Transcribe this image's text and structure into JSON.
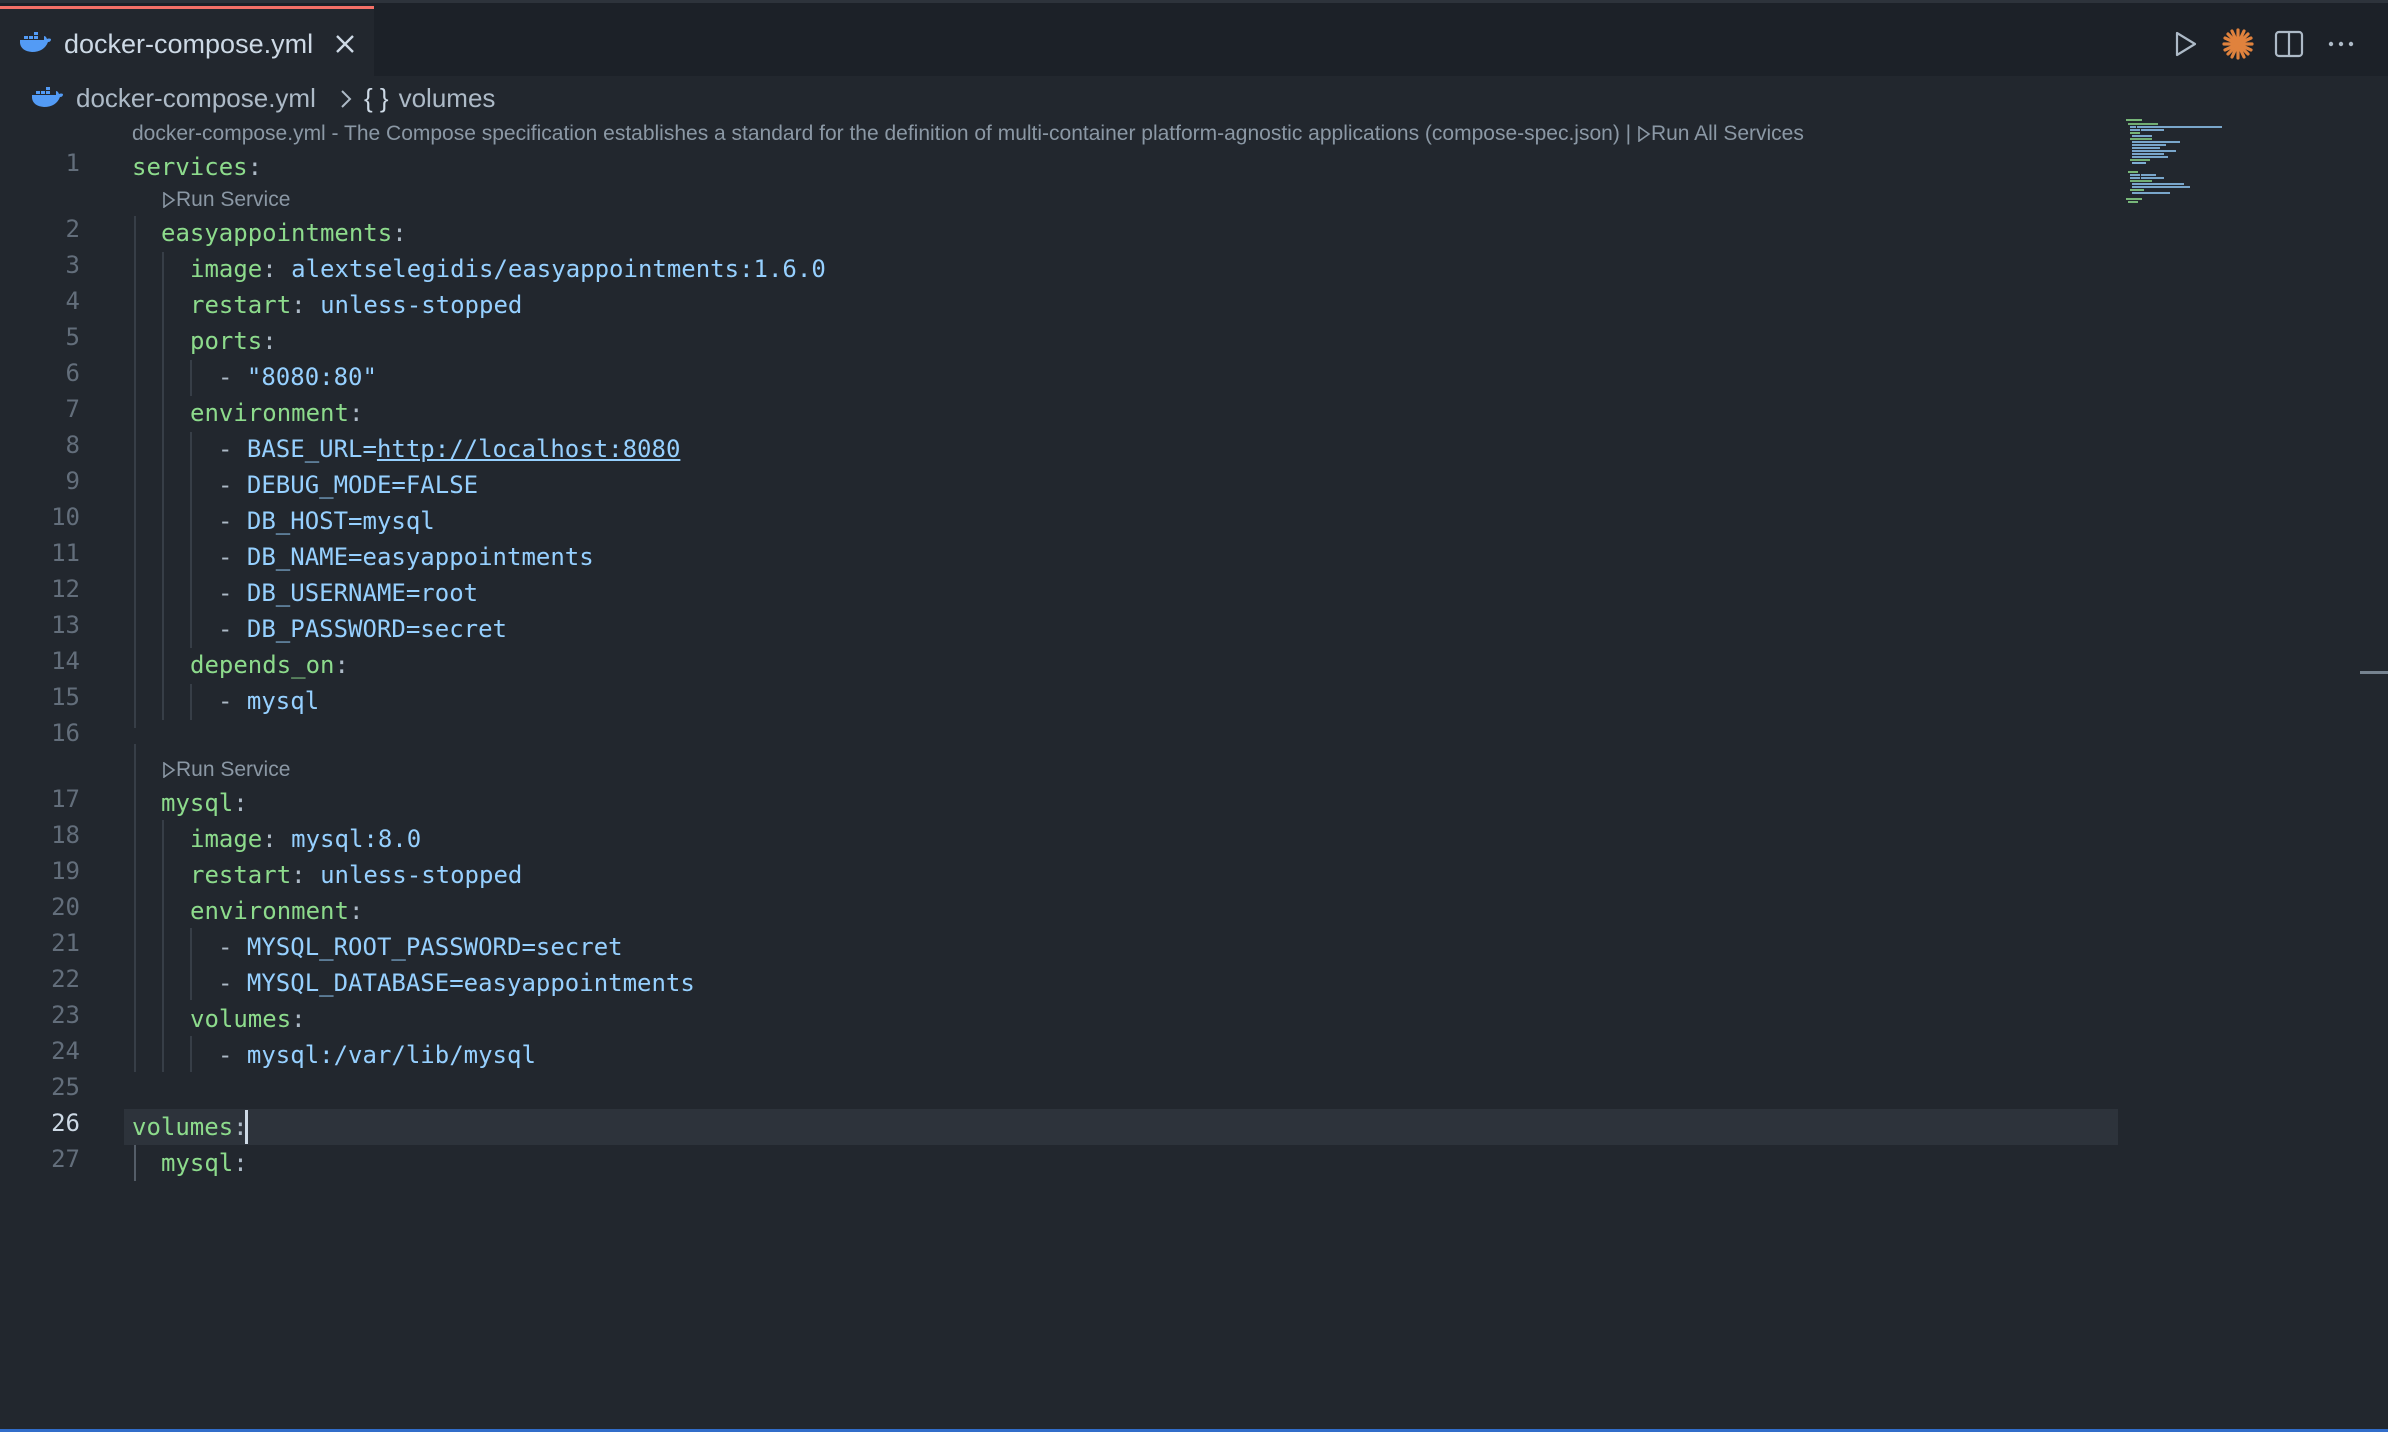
{
  "tab": {
    "label": "docker-compose.yml",
    "icon": "docker-whale-icon",
    "close_icon": "close-icon"
  },
  "toolbar": {
    "run_icon": "run-icon",
    "claude_icon": "sparkle-icon",
    "split_icon": "split-editor-icon",
    "more_icon": "more-actions-icon"
  },
  "breadcrumb": {
    "file": "docker-compose.yml",
    "symbol_braces": "{ }",
    "symbol": "volumes"
  },
  "codelens_top": {
    "schema": "docker-compose.yml - The Compose specification establishes a standard for the definition of multi-container platform-agnostic applications (compose-spec.json) | ",
    "run_all": "Run All Services"
  },
  "run_service_label": "Run Service",
  "lines": {
    "l1": {
      "num": "1",
      "key": "services",
      "colon": ":"
    },
    "l2": {
      "num": "2",
      "key": "easyappointments",
      "colon": ":"
    },
    "l3": {
      "num": "3",
      "key": "image",
      "colon": ":",
      "value": "alextselegidis/easyappointments:1.6.0"
    },
    "l4": {
      "num": "4",
      "key": "restart",
      "colon": ":",
      "value": "unless-stopped"
    },
    "l5": {
      "num": "5",
      "key": "ports",
      "colon": ":"
    },
    "l6": {
      "num": "6",
      "dash": "- ",
      "value": "\"8080:80\""
    },
    "l7": {
      "num": "7",
      "key": "environment",
      "colon": ":"
    },
    "l8": {
      "num": "8",
      "dash": "- ",
      "value": "BASE_URL=",
      "link": "http://localhost:8080"
    },
    "l9": {
      "num": "9",
      "dash": "- ",
      "value": "DEBUG_MODE=FALSE"
    },
    "l10": {
      "num": "10",
      "dash": "- ",
      "value": "DB_HOST=mysql"
    },
    "l11": {
      "num": "11",
      "dash": "- ",
      "value": "DB_NAME=easyappointments"
    },
    "l12": {
      "num": "12",
      "dash": "- ",
      "value": "DB_USERNAME=root"
    },
    "l13": {
      "num": "13",
      "dash": "- ",
      "value": "DB_PASSWORD=secret"
    },
    "l14": {
      "num": "14",
      "key": "depends_on",
      "colon": ":"
    },
    "l15": {
      "num": "15",
      "dash": "- ",
      "value": "mysql"
    },
    "l16": {
      "num": "16"
    },
    "l17": {
      "num": "17",
      "key": "mysql",
      "colon": ":"
    },
    "l18": {
      "num": "18",
      "key": "image",
      "colon": ":",
      "value": "mysql:8.0"
    },
    "l19": {
      "num": "19",
      "key": "restart",
      "colon": ":",
      "value": "unless-stopped"
    },
    "l20": {
      "num": "20",
      "key": "environment",
      "colon": ":"
    },
    "l21": {
      "num": "21",
      "dash": "- ",
      "value": "MYSQL_ROOT_PASSWORD=secret"
    },
    "l22": {
      "num": "22",
      "dash": "- ",
      "value": "MYSQL_DATABASE=easyappointments"
    },
    "l23": {
      "num": "23",
      "key": "volumes",
      "colon": ":"
    },
    "l24": {
      "num": "24",
      "dash": "- ",
      "value": "mysql:/var/lib/mysql"
    },
    "l25": {
      "num": "25"
    },
    "l26": {
      "num": "26",
      "key": "volumes",
      "colon": ":"
    },
    "l27": {
      "num": "27",
      "key": "mysql",
      "colon": ":"
    }
  },
  "colors": {
    "editor_bg": "#22272e",
    "tab_accent": "#f47067",
    "key": "#8ddb8c",
    "value": "#96d0ff",
    "status_bar": "#316dca"
  }
}
